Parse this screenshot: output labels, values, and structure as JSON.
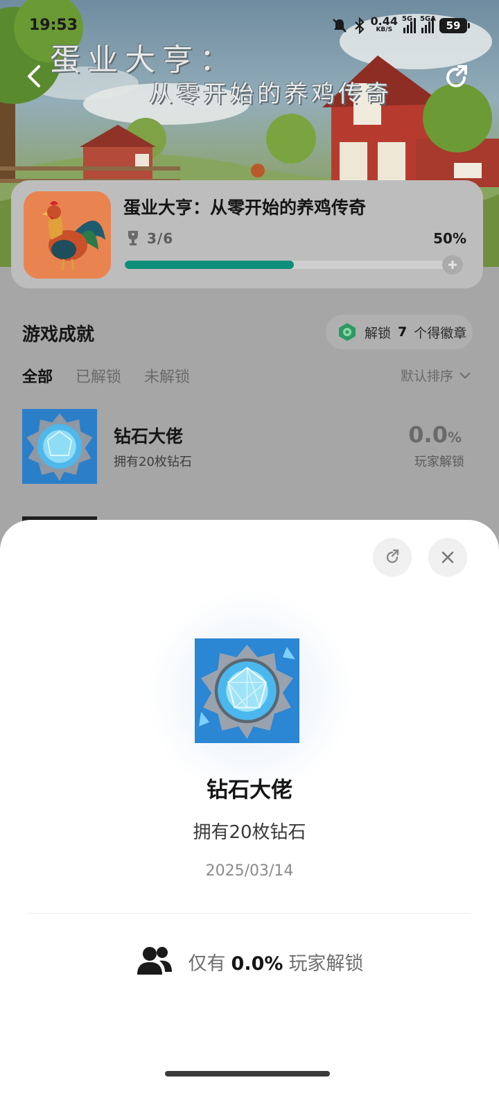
{
  "status_bar": {
    "time": "19:53",
    "net_speed_value": "0.44",
    "net_speed_unit": "KB/S",
    "signal_1_label": "5G",
    "signal_2_label": "5GA",
    "battery": "59"
  },
  "hero": {
    "title_line_1": "蛋业大亨：",
    "title_line_2": "从零开始的养鸡传奇"
  },
  "game": {
    "name": "蛋业大亨：从零开始的养鸡传奇",
    "progress_count": "3/6",
    "progress_percent_label": "50%",
    "progress_value": 0.5,
    "accent_color": "#0f8f7b"
  },
  "achievements": {
    "section_title": "游戏成就",
    "badge_pill": {
      "prefix": "解锁",
      "count": "7",
      "suffix": "个得徽章"
    },
    "filters": [
      "全部",
      "已解锁",
      "未解锁"
    ],
    "active_filter": "全部",
    "sort_label": "默认排序",
    "items": [
      {
        "name": "钻石大佬",
        "description": "拥有20枚钻石",
        "percent": "0.0",
        "percent_unit": "%",
        "percent_label": "玩家解锁"
      }
    ]
  },
  "detail_sheet": {
    "name": "钻石大佬",
    "description": "拥有20枚钻石",
    "date": "2025/03/14",
    "stat_prefix": "仅有",
    "stat_value": "0.0%",
    "stat_suffix": "玩家解锁"
  },
  "icons": {
    "back": "chevron-left-icon",
    "share": "share-icon",
    "close": "close-icon",
    "trophy": "trophy-icon",
    "users": "users-icon",
    "sort": "chevron-down-icon"
  }
}
